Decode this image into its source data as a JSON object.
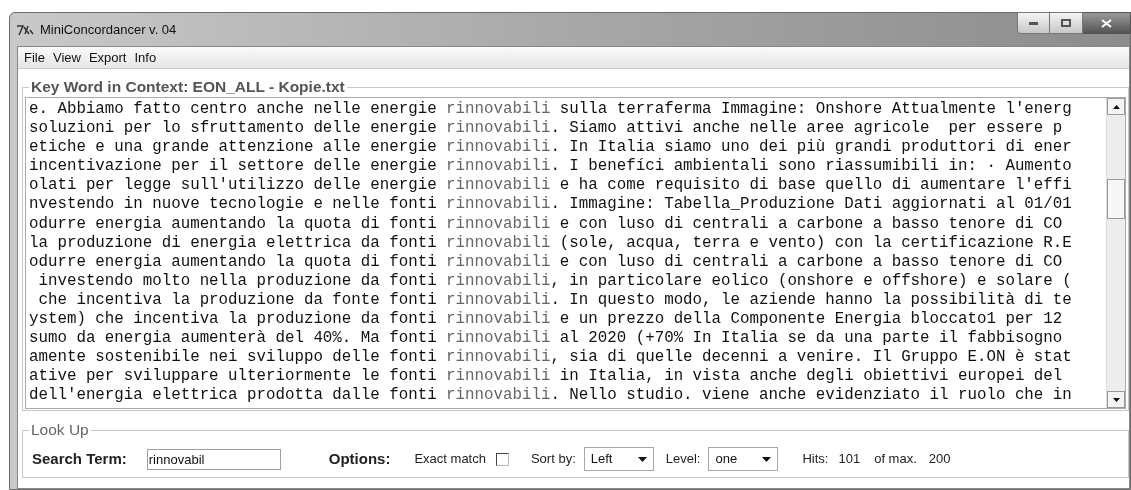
{
  "window": {
    "title": "MiniConcordancer v. 04"
  },
  "menu": [
    "File",
    "View",
    "Export",
    "Info"
  ],
  "kwic": {
    "title": "Key Word in Context: EON_ALL - Kopie.txt",
    "lines": [
      {
        "left": "e. Abbiamo fatto centro anche nelle energie ",
        "keyword": "rinnovabili",
        "right": " sulla terraferma Immagine: Onshore Attualmente l'energ"
      },
      {
        "left": "soluzioni per lo sfruttamento delle energie ",
        "keyword": "rinnovabili",
        "right": ". Siamo attivi anche nelle aree agricole  per essere p"
      },
      {
        "left": "etiche e una grande attenzione alle energie ",
        "keyword": "rinnovabili",
        "right": ". In Italia siamo uno dei più grandi produttori di ener"
      },
      {
        "left": "incentivazione per il settore delle energie ",
        "keyword": "rinnovabili",
        "right": ". I benefíci ambientali sono riassumibili in: · Aumento"
      },
      {
        "left": "olati per legge sull'utilizzo delle energie ",
        "keyword": "rinnovabili",
        "right": " e ha come requisito di base quello di aumentare l'effi"
      },
      {
        "left": "nvestendo in nuove tecnologie e nelle fonti ",
        "keyword": "rinnovabili",
        "right": ". Immagine: Tabella_Produzione Dati aggiornati al 01/01"
      },
      {
        "left": "odurre energia aumentando la quota di fonti ",
        "keyword": "rinnovabili",
        "right": " e con luso di centrali a carbone a basso tenore di CO"
      },
      {
        "left": "la produzione di energia elettrica da fonti ",
        "keyword": "rinnovabili",
        "right": " (sole, acqua, terra e vento) con la certificazione R.E"
      },
      {
        "left": "odurre energia aumentando la quota di fonti ",
        "keyword": "rinnovabili",
        "right": " e con luso di centrali a carbone a basso tenore di CO"
      },
      {
        "left": " investendo molto nella produzione da fonti ",
        "keyword": "rinnovabili",
        "right": ", in particolare eolico (onshore e offshore) e solare ("
      },
      {
        "left": " che incentiva la produzione da fonte fonti ",
        "keyword": "rinnovabili",
        "right": ". In questo modo, le aziende hanno la possibilità di te"
      },
      {
        "left": "ystem) che incentiva la produzione da fonti ",
        "keyword": "rinnovabili",
        "right": " e un prezzo della Componente Energia bloccato1 per 12"
      },
      {
        "left": "sumo da energia aumenterà del 40%. Ma fonti ",
        "keyword": "rinnovabili",
        "right": " al 2020 (+70% In Italia se da una parte il fabbisogno"
      },
      {
        "left": "amente sostenibile nei sviluppo delle fonti ",
        "keyword": "rinnovabili",
        "right": ", sia di quelle decenni a venire. Il Gruppo E.ON è stat"
      },
      {
        "left": "ative per sviluppare ulteriormente le fonti ",
        "keyword": "rinnovabili",
        "right": " in Italia, in vista anche degli obiettivi europei del"
      },
      {
        "left": "dell'energia elettrica prodotta dalle fonti ",
        "keyword": "rinnovabili",
        "right": ". Nello studio. viene anche evidenziato il ruolo che in"
      }
    ]
  },
  "lookup": {
    "title": "Look Up",
    "search_label": "Search Term:",
    "search_value": "rinnovabil",
    "options_label": "Options:",
    "exact_label": "Exact match",
    "exact_checked": false,
    "sort_label": "Sort by:",
    "sort_value": "Left",
    "level_label": "Level:",
    "level_value": "one",
    "hits_label": "Hits:",
    "hits": "101",
    "max_label": "of max.",
    "max": "200"
  }
}
